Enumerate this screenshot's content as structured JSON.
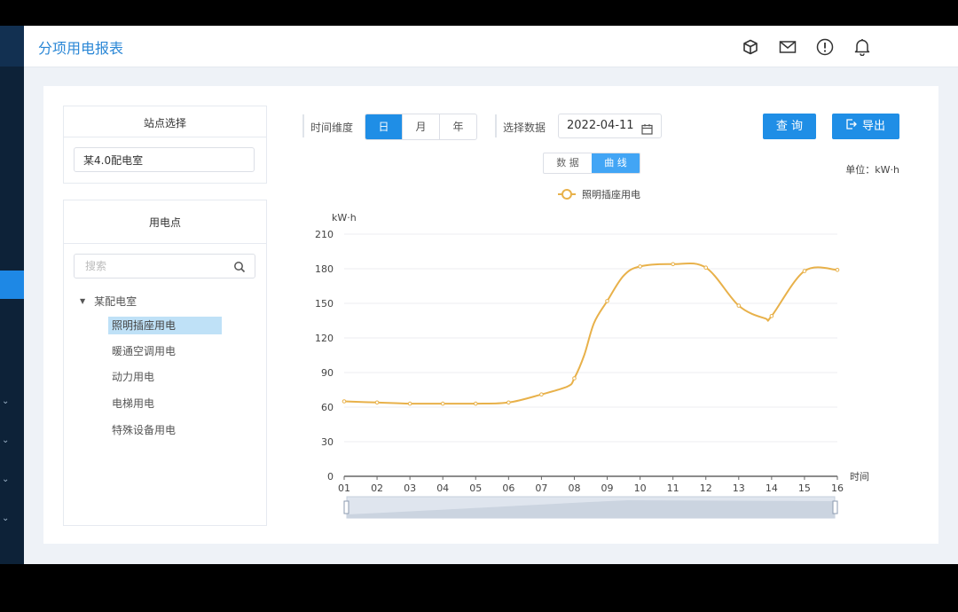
{
  "header": {
    "title": "分项用电报表"
  },
  "site_card": {
    "title": "站点选择",
    "selected": "某4.0配电室"
  },
  "point_card": {
    "title": "用电点",
    "search_placeholder": "搜索",
    "root": "某配电室",
    "items": [
      "照明插座用电",
      "暖通空调用电",
      "动力用电",
      "电梯用电",
      "特殊设备用电"
    ]
  },
  "toolbar": {
    "dim_label": "时间维度",
    "dims": [
      "日",
      "月",
      "年"
    ],
    "select_label": "选择数据",
    "date": "2022-04-11",
    "query": "查 询",
    "export": "导出"
  },
  "view_toggle": [
    "数 据",
    "曲 线"
  ],
  "unit": "单位：kW·h",
  "accent": "#1f8ee6",
  "chart_data": {
    "type": "line",
    "ylabel": "kW·h",
    "xlabel": "时间",
    "ylim": [
      0,
      210
    ],
    "yticks": [
      0,
      30,
      60,
      90,
      120,
      150,
      180,
      210
    ],
    "categories": [
      "01",
      "02",
      "03",
      "04",
      "05",
      "06",
      "07",
      "08",
      "09",
      "10",
      "11",
      "12",
      "13",
      "14",
      "15",
      "16"
    ],
    "series": [
      {
        "name": "照明插座用电",
        "color": "#e8b14a",
        "x": [
          1,
          2,
          3,
          4,
          5,
          6,
          7,
          7.8,
          8,
          8.3,
          8.6,
          9,
          9.5,
          10,
          11,
          12,
          13,
          13.8,
          14,
          15,
          16
        ],
        "values": [
          65,
          64,
          63,
          63,
          63,
          64,
          71,
          78,
          85,
          105,
          133,
          152,
          174,
          182,
          184,
          181,
          148,
          137,
          139,
          178,
          179
        ]
      }
    ],
    "grid": true,
    "legend": "top-center"
  }
}
